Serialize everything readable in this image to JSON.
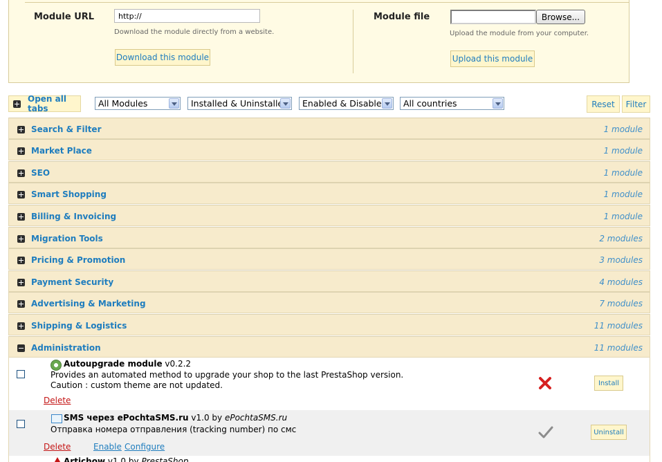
{
  "upload": {
    "url_label": "Module URL",
    "url_value": "http://",
    "url_hint": "Download the module directly from a website.",
    "download_button": "Download this module",
    "file_label": "Module file",
    "browse_button": "Browse...",
    "file_hint": "Upload the module from your computer.",
    "upload_button": "Upload this module"
  },
  "filters": {
    "open_all_tabs": "Open all tabs",
    "module_type": "All Modules",
    "install_status": "Installed & Uninstalled",
    "enable_status": "Enabled & Disabled",
    "country": "All countries",
    "reset": "Reset",
    "filter": "Filter"
  },
  "categories": [
    {
      "name": "Search & Filter",
      "count": "1 module"
    },
    {
      "name": "Market Place",
      "count": "1 module"
    },
    {
      "name": "SEO",
      "count": "1 module"
    },
    {
      "name": "Smart Shopping",
      "count": "1 module"
    },
    {
      "name": "Billing & Invoicing",
      "count": "1 module"
    },
    {
      "name": "Migration Tools",
      "count": "2 modules"
    },
    {
      "name": "Pricing & Promotion",
      "count": "3 modules"
    },
    {
      "name": "Payment Security",
      "count": "4 modules"
    },
    {
      "name": "Advertising & Marketing",
      "count": "7 modules"
    },
    {
      "name": "Shipping & Logistics",
      "count": "11 modules"
    },
    {
      "name": "Administration",
      "count": "11 modules"
    }
  ],
  "modules": [
    {
      "name": "Autoupgrade module",
      "version": "v0.2.2",
      "desc1": "Provides an automated method to upgrade your shop to the last PrestaShop version.",
      "desc2": "Caution : custom theme are not updated.",
      "delete": "Delete",
      "status": "not installed",
      "action": "Install",
      "icon": "gear-icon"
    },
    {
      "name": "SMS через ePochtaSMS.ru",
      "version": "v1.0",
      "by": "by",
      "author": "ePochtaSMS.ru",
      "desc1": "Отправка номера отправления (tracking number) по смс",
      "delete": "Delete",
      "enable": "Enable",
      "configure": "Configure",
      "status": "installed",
      "action": "Uninstall",
      "icon": "mail-icon"
    },
    {
      "name": "Artichow",
      "version": "v1.0",
      "by": "by",
      "author": "PrestaShop",
      "icon": "warning-icon"
    }
  ],
  "colors": {
    "link_blue": "#1f7dbe",
    "panel_bg": "#fffbe4",
    "category_bg": "#f7ebcc",
    "delete_red": "#c41515"
  }
}
